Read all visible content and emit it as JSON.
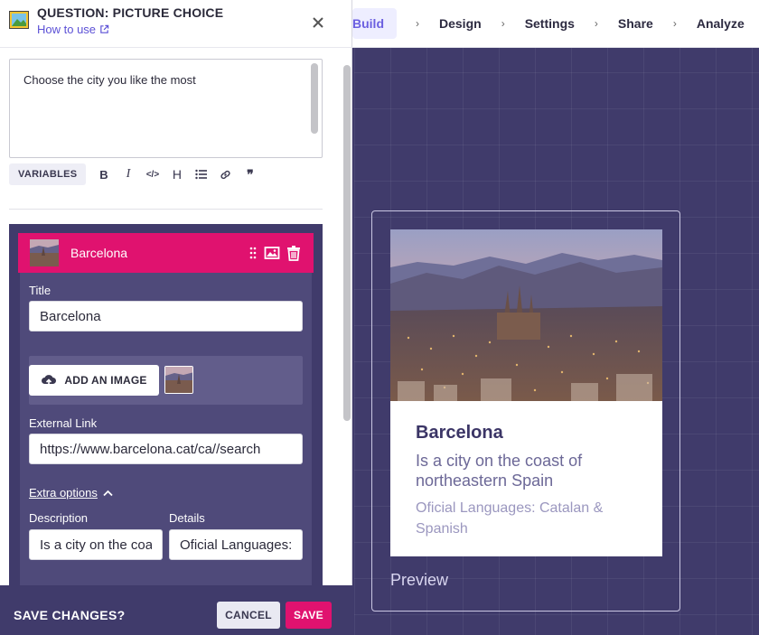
{
  "nav": {
    "steps": [
      "Build",
      "Design",
      "Settings",
      "Share",
      "Analyze"
    ],
    "separator": "›",
    "active_index": 0
  },
  "panel": {
    "title": "QUESTION: PICTURE CHOICE",
    "how_to": "How to use",
    "question_text": "Choose the city you like the most"
  },
  "toolbar": {
    "variables_label": "VARIABLES",
    "tools": [
      "bold",
      "italic",
      "code",
      "heading",
      "list",
      "link",
      "quote"
    ],
    "bold_glyph": "B",
    "italic_glyph": "I",
    "code_glyph": "</>",
    "heading_glyph": "H",
    "quote_glyph": "❞"
  },
  "choice": {
    "name": "Barcelona",
    "title_label": "Title",
    "title_value": "Barcelona",
    "add_image_label": "ADD AN IMAGE",
    "external_link_label": "External Link",
    "external_link_value": "https://www.barcelona.cat/ca//search",
    "extra_options_label": "Extra options",
    "description_label": "Description",
    "description_value": "Is a city on the coast of northeastern Spain",
    "details_label": "Details",
    "details_value": "Oficial Languages: Catalan & Spanish"
  },
  "preview": {
    "title": "Barcelona",
    "description": "Is a city on the coast of northeastern Spain",
    "details": "Oficial Languages: Catalan & Spanish",
    "label": "Preview"
  },
  "savebar": {
    "question": "SAVE CHANGES?",
    "cancel_label": "CANCEL",
    "save_label": "SAVE"
  },
  "colors": {
    "accent_pink": "#e0126f",
    "canvas": "#403b6b",
    "link": "#5c51d6"
  }
}
